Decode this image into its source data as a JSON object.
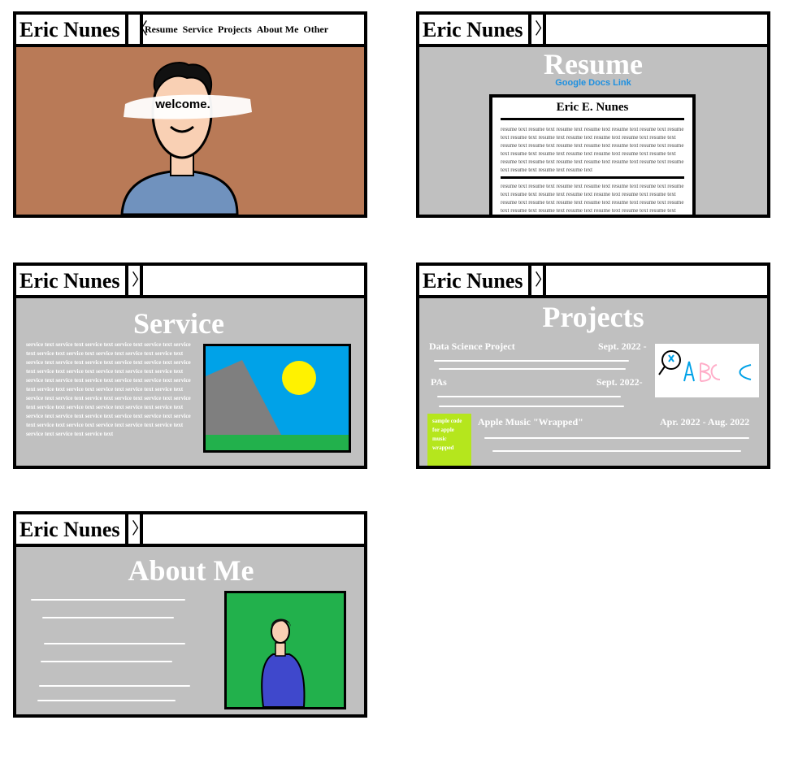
{
  "site": {
    "name": "Eric Nunes"
  },
  "nav": {
    "collapsed_arrow": "〉",
    "expanded_arrow": "〈",
    "items": [
      "Resume",
      "Service",
      "Projects",
      "About Me",
      "Other"
    ]
  },
  "home": {
    "welcome": "welcome."
  },
  "resume": {
    "title": "Resume",
    "link": "Google Docs Link",
    "doc_name": "Eric E. Nunes",
    "block1": "resume text resume text resume text resume text resume text resume text resume text resume text resume text resume text resume text resume text resume text resume text resume text resume text resume text resume text resume text resume text resume text resume text resume text resume text resume text resume text resume text resume text resume text resume text resume text resume text resume text resume text resume text resume text",
    "block2": "resume text resume text resume text resume text resume text resume text resume text resume text resume text resume text resume text resume text resume text resume text resume text resume text resume text resume text resume text resume text resume text resume text resume text resume text resume text resume text"
  },
  "service": {
    "title": "Service",
    "text": "service text service text service text service text service text service text service text service text service text service text service text service text service text service text service text service text service text service text service text service text service text service text service text service text service text service text service text service text service text service text service text service text service text service text service text service text service text service text service text service text service text service text service text service text service text service text service text service text service text service text service text service text service text service text service text service text service text service text"
  },
  "projects": {
    "title": "Projects",
    "items": [
      {
        "name": "Data Science Project",
        "date": "Sept. 2022 -"
      },
      {
        "name": "PAs",
        "date": "Sept. 2022-"
      },
      {
        "name": "Apple Music \"Wrapped\"",
        "date": "Apr. 2022 - Aug. 2022"
      }
    ],
    "sample_code": "sample code for apple music wrapped"
  },
  "about": {
    "title": "About Me"
  },
  "colors": {
    "home_bg": "#b97a57",
    "content_bg": "#c0c0c0",
    "link_blue": "#1e90e0",
    "sky": "#00a2e8",
    "sun": "#fff200",
    "grass": "#22b14c",
    "mountain": "#7f7f7f",
    "shirt": "#7092be",
    "skin": "#f9d0b4",
    "lime": "#b5e61d",
    "about_bg": "#22b14c",
    "about_shirt": "#3f48cc"
  }
}
